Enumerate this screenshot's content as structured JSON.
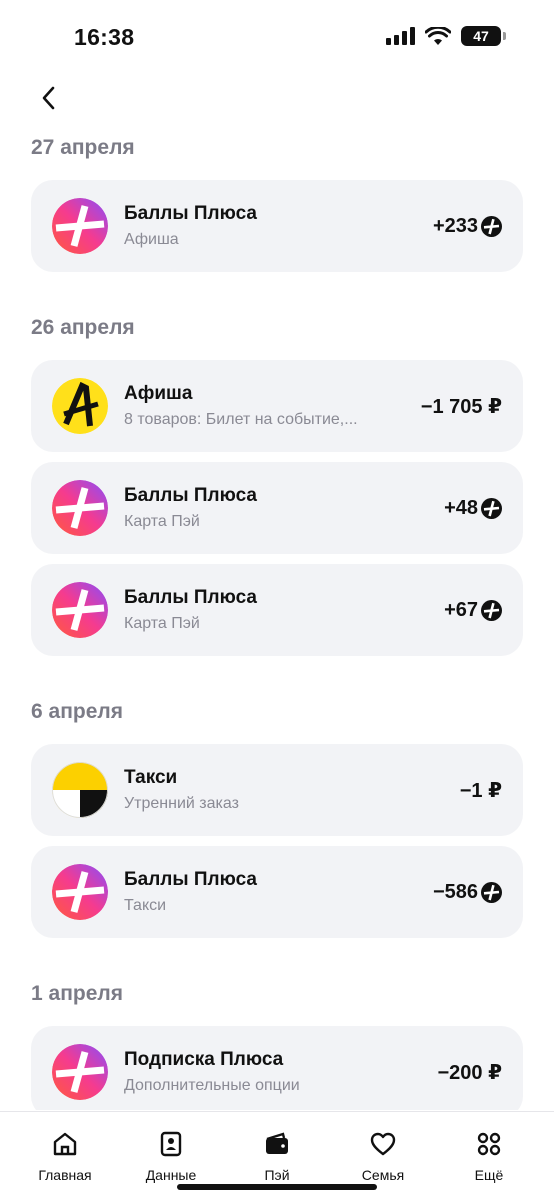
{
  "status_bar": {
    "time": "16:38",
    "battery_level": "47"
  },
  "colors": {
    "card_bg": "#f2f3f6",
    "date_heading": "#7b7b86",
    "subtitle": "#8a8a94",
    "afisha_yellow": "#ffe01a",
    "taxi_yellow": "#fcd000"
  },
  "groups": [
    {
      "date": "27 апреля",
      "items": [
        {
          "icon": "plus-points-icon",
          "title": "Баллы Плюса",
          "subtitle": "Афиша",
          "amount": "+233",
          "currency": "plus-coin"
        }
      ]
    },
    {
      "date": "26 апреля",
      "items": [
        {
          "icon": "afisha-icon",
          "title": "Афиша",
          "subtitle": "8 товаров: Билет на событие,...",
          "amount": "−1 705 ₽",
          "currency": "rub"
        },
        {
          "icon": "plus-points-icon",
          "title": "Баллы Плюса",
          "subtitle": "Карта Пэй",
          "amount": "+48",
          "currency": "plus-coin"
        },
        {
          "icon": "plus-points-icon",
          "title": "Баллы Плюса",
          "subtitle": "Карта Пэй",
          "amount": "+67",
          "currency": "plus-coin"
        }
      ]
    },
    {
      "date": "6 апреля",
      "items": [
        {
          "icon": "taxi-icon",
          "title": "Такси",
          "subtitle": "Утренний заказ",
          "amount": "−1 ₽",
          "currency": "rub"
        },
        {
          "icon": "plus-points-icon",
          "title": "Баллы Плюса",
          "subtitle": "Такси",
          "amount": "−586",
          "currency": "plus-coin"
        }
      ]
    },
    {
      "date": "1 апреля",
      "items": [
        {
          "icon": "plus-points-icon",
          "title": "Подписка Плюса",
          "subtitle": "Дополнительные опции",
          "amount": "−200 ₽",
          "currency": "rub"
        }
      ]
    }
  ],
  "tab_bar": [
    {
      "icon": "home-icon",
      "label": "Главная"
    },
    {
      "icon": "data-icon",
      "label": "Данные"
    },
    {
      "icon": "wallet-icon",
      "label": "Пэй"
    },
    {
      "icon": "heart-icon",
      "label": "Семья"
    },
    {
      "icon": "grid-icon",
      "label": "Ещё"
    }
  ]
}
